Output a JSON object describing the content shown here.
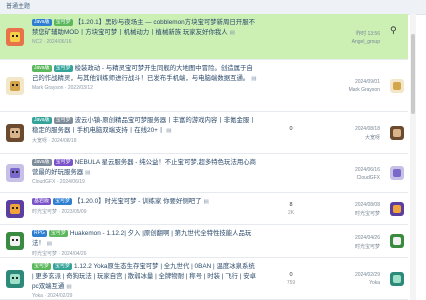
{
  "section": {
    "title": "普通主题"
  },
  "threads": [
    {
      "prefixes": [
        "Java版",
        "宝可梦"
      ],
      "title": "【1.20.1】黑砂与夜场主 — cobblemon方块宝可梦新周日开服不禁您矿辅助MOD丨方块宝可梦丨机械动力丨植械新族 玩家友好你我人",
      "author": "NC2",
      "date": "2024/06/16",
      "replies": "",
      "views": "",
      "last_time": "昨时 13:56",
      "last_user": "Angel_group",
      "avatar_colors": [
        "#e8734a",
        "#f7d04a"
      ],
      "sticky": true
    },
    {
      "prefixes": [
        "Java版",
        "宝可梦"
      ],
      "title": "梭装政动 - 与精灵宝可梦开生同舰的大地图中冒险。创造属于自己的作战精灵，与其他训练师进行战斗！已发布手机端，与电脑端数据互通。",
      "author": "Mark Grayson",
      "date": "2022/03/12",
      "replies": "",
      "views": "",
      "last_time": "2024/09/01",
      "last_user": "Mark Grayson",
      "avatar_colors": [
        "#f3e7c9",
        "#d4a54a"
      ]
    },
    {
      "prefixes": [
        "Java版",
        "宝可梦"
      ],
      "title": "波云小镇-原创精品宝可梦服务器丨丰富的游戏内容丨非氪金服丨稳定的服务器丨手机电脑双端支持丨在线20+丨",
      "author": "大宽呀",
      "date": "2024/08/18",
      "replies": "0",
      "views": "",
      "last_time": "2024/08/18",
      "last_user": "大宽呀",
      "avatar_colors": [
        "#6b4a2f",
        "#d9b48a"
      ]
    },
    {
      "prefixes": [
        "Java版",
        "宝可梦"
      ],
      "title": "NEBULA 星云服务器 - 纯公益！不止宝可梦,超多特色玩法用心商营最的好玩服务器",
      "author": "CloudGFX",
      "date": "2024/06/19",
      "replies": "",
      "views": "",
      "last_time": "2024/06/16",
      "last_user": "CloudGFX",
      "avatar_colors": [
        "#c7c1e8",
        "#7b68c9"
      ]
    },
    {
      "prefixes": [
        "基岩版",
        "宝可梦"
      ],
      "title": "【1.20.0】时光宝可梦 - 训练家 你要好侧吧了",
      "author": "时光宝可梦",
      "date": "2023/05/09",
      "replies": "8",
      "views": "2K",
      "last_time": "2024/08/08",
      "last_user": "时光宝可梦",
      "avatar_colors": [
        "#5a3fa0",
        "#f0a43a"
      ]
    },
    {
      "prefixes": [
        "RPG",
        "宝可梦"
      ],
      "title": "Huakemon - 1.12.2| 夕入 |原创翻啊 | 第九世代全特性技能人品玩法！",
      "author": "时光宝可梦",
      "date": "2024/04/26",
      "replies": "",
      "views": "",
      "last_time": "2024/04/26",
      "last_user": "时光宝可梦",
      "avatar_colors": [
        "#3a8a3f",
        "#f2f2f2"
      ]
    },
    {
      "prefixes": [
        "宝可梦",
        "宝可梦"
      ],
      "title": "1.12.2 Yoka原生态生存宝可梦 | 全九世代 | 0BAN | 温度冰泉系统 | 更多玄派 | 奇狗玩法 | 玩家自宫 | 散弱冰量 | 全牌物耐 | 称号 | 时装 | 飞行 | 安卓pc双端互通",
      "author": "Yoka",
      "date": "2024/02/29",
      "replies": "0",
      "views": "759",
      "last_time": "2024/02/29",
      "last_user": "Yoka",
      "avatar_colors": [
        "#2d8a7a",
        "#9fe0c8"
      ]
    }
  ]
}
